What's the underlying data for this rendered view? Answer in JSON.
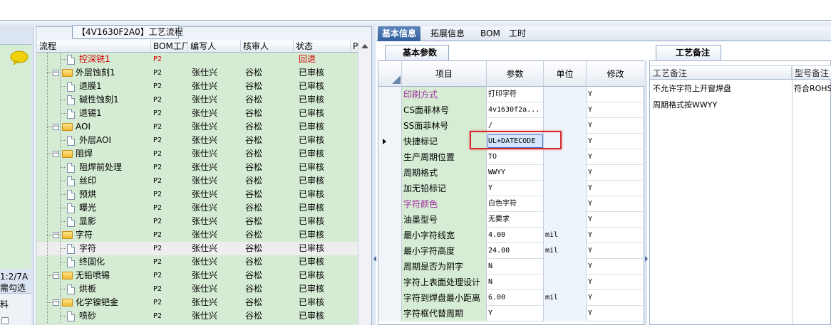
{
  "flow_tab": "【4V1630F2A0】工艺流程",
  "left_side": {
    "label1": "1:2/7A",
    "label2": "需勾选",
    "grid_header": "料"
  },
  "tree": {
    "headers": [
      "流程",
      "BOM工厂",
      "编写人",
      "核审人",
      "状态",
      "P"
    ],
    "rows": [
      {
        "name": "控深铣1",
        "factory": "P2",
        "writer": "",
        "reviewer": "",
        "status": "回退",
        "type": "file",
        "level": 2,
        "red": true
      },
      {
        "name": "外层蚀刻1",
        "factory": "P2",
        "writer": "张仕兴",
        "reviewer": "谷松",
        "status": "已审核",
        "type": "folder",
        "level": 1
      },
      {
        "name": "退膜1",
        "factory": "P2",
        "writer": "张仕兴",
        "reviewer": "谷松",
        "status": "已审核",
        "type": "file",
        "level": 2
      },
      {
        "name": "碱性蚀刻1",
        "factory": "P2",
        "writer": "张仕兴",
        "reviewer": "谷松",
        "status": "已审核",
        "type": "file",
        "level": 2
      },
      {
        "name": "退锡1",
        "factory": "P2",
        "writer": "张仕兴",
        "reviewer": "谷松",
        "status": "已审核",
        "type": "file",
        "level": 2
      },
      {
        "name": "AOI",
        "factory": "P2",
        "writer": "张仕兴",
        "reviewer": "谷松",
        "status": "已审核",
        "type": "folder",
        "level": 1
      },
      {
        "name": "外层AOI",
        "factory": "P2",
        "writer": "张仕兴",
        "reviewer": "谷松",
        "status": "已审核",
        "type": "file",
        "level": 2
      },
      {
        "name": "阻焊",
        "factory": "P2",
        "writer": "张仕兴",
        "reviewer": "谷松",
        "status": "已审核",
        "type": "folder",
        "level": 1
      },
      {
        "name": "阻焊前处理",
        "factory": "P2",
        "writer": "张仕兴",
        "reviewer": "谷松",
        "status": "已审核",
        "type": "file",
        "level": 2
      },
      {
        "name": "丝印",
        "factory": "P2",
        "writer": "张仕兴",
        "reviewer": "谷松",
        "status": "已审核",
        "type": "file",
        "level": 2
      },
      {
        "name": "预烘",
        "factory": "P2",
        "writer": "张仕兴",
        "reviewer": "谷松",
        "status": "已审核",
        "type": "file",
        "level": 2
      },
      {
        "name": "曝光",
        "factory": "P2",
        "writer": "张仕兴",
        "reviewer": "谷松",
        "status": "已审核",
        "type": "file",
        "level": 2
      },
      {
        "name": "显影",
        "factory": "P2",
        "writer": "张仕兴",
        "reviewer": "谷松",
        "status": "已审核",
        "type": "file",
        "level": 2
      },
      {
        "name": "字符",
        "factory": "P2",
        "writer": "张仕兴",
        "reviewer": "谷松",
        "status": "已审核",
        "type": "folder",
        "level": 1
      },
      {
        "name": "字符",
        "factory": "P2",
        "writer": "张仕兴",
        "reviewer": "谷松",
        "status": "已审核",
        "type": "file",
        "level": 2,
        "selected": true
      },
      {
        "name": "终固化",
        "factory": "P2",
        "writer": "张仕兴",
        "reviewer": "谷松",
        "status": "已审核",
        "type": "file",
        "level": 2
      },
      {
        "name": "无铅喷锡",
        "factory": "P2",
        "writer": "张仕兴",
        "reviewer": "谷松",
        "status": "已审核",
        "type": "folder",
        "level": 1
      },
      {
        "name": "烘板",
        "factory": "P2",
        "writer": "张仕兴",
        "reviewer": "谷松",
        "status": "已审核",
        "type": "file",
        "level": 2
      },
      {
        "name": "化学镍钯金",
        "factory": "P2",
        "writer": "张仕兴",
        "reviewer": "谷松",
        "status": "已审核",
        "type": "folder",
        "level": 1
      },
      {
        "name": "喷砂",
        "factory": "P2",
        "writer": "张仕兴",
        "reviewer": "谷松",
        "status": "已审核",
        "type": "file",
        "level": 2
      }
    ]
  },
  "right_tabs": [
    "基本信息",
    "拓展信息",
    "BOM",
    "工时"
  ],
  "param_panel_title": "基本参数",
  "param_headers": [
    "项目",
    "参数",
    "单位",
    "修改"
  ],
  "params": [
    {
      "item": "印刷方式",
      "value": "打印字符",
      "unit": "",
      "mod": "Y",
      "purple": true
    },
    {
      "item": "CS面菲林号",
      "value": "4v1630f2a...",
      "unit": "",
      "mod": "Y"
    },
    {
      "item": "SS面菲林号",
      "value": "/",
      "unit": "",
      "mod": "Y"
    },
    {
      "item": "快捷标记",
      "value": "UL+DATECODE",
      "unit": "",
      "mod": "Y",
      "current": true
    },
    {
      "item": "生产周期位置",
      "value": "TO",
      "unit": "",
      "mod": "Y"
    },
    {
      "item": "周期格式",
      "value": "WWYY",
      "unit": "",
      "mod": "Y"
    },
    {
      "item": "加无铅标记",
      "value": "Y",
      "unit": "",
      "mod": "Y"
    },
    {
      "item": "字符颜色",
      "value": "白色字符",
      "unit": "",
      "mod": "Y",
      "purple": true
    },
    {
      "item": "油墨型号",
      "value": "无要求",
      "unit": "",
      "mod": "Y"
    },
    {
      "item": "最小字符线宽",
      "value": "4.00",
      "unit": "mil",
      "mod": "Y"
    },
    {
      "item": "最小字符高度",
      "value": "24.00",
      "unit": "mil",
      "mod": "Y"
    },
    {
      "item": "周期是否为阴字",
      "value": "N",
      "unit": "",
      "mod": "Y"
    },
    {
      "item": "字符上表面处理设计",
      "value": "N",
      "unit": "",
      "mod": "Y"
    },
    {
      "item": "字符到焊盘最小距离",
      "value": "6.00",
      "unit": "mil",
      "mod": "Y"
    },
    {
      "item": "字符框代替周期",
      "value": "Y",
      "unit": "",
      "mod": "Y"
    }
  ],
  "note_panel_title": "工艺备注",
  "note_headers": [
    "工艺备注",
    "型号备注"
  ],
  "notes": [
    "不允许字符上开窗焊盘",
    "周期格式按WWYY"
  ],
  "model_note": "符合ROHS标"
}
